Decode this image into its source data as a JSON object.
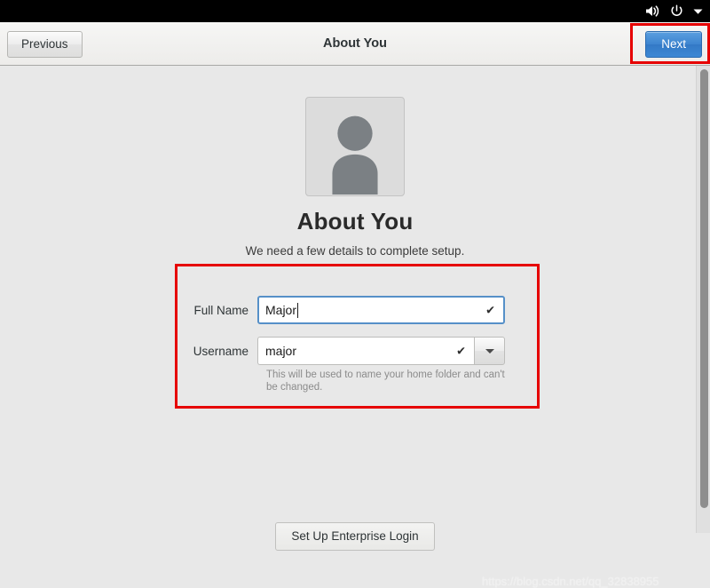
{
  "system_bar": {
    "icons": [
      {
        "name": "volume-icon",
        "label": "Volume"
      },
      {
        "name": "power-icon",
        "label": "Power"
      },
      {
        "name": "chevron-down-icon",
        "label": "System menu"
      }
    ]
  },
  "header": {
    "title": "About You",
    "previous_label": "Previous",
    "next_label": "Next"
  },
  "main": {
    "avatar_alt": "user-avatar-placeholder",
    "title": "About You",
    "subtitle": "We need a few details to complete setup.",
    "fields": [
      {
        "name": "full-name",
        "label": "Full Name",
        "value": "Major",
        "placeholder": "",
        "focused": true,
        "valid_icon": "✔",
        "has_dropdown": false
      },
      {
        "name": "username",
        "label": "Username",
        "value": "major",
        "placeholder": "",
        "focused": false,
        "valid_icon": "✔",
        "has_dropdown": true
      }
    ],
    "hint": "This will be used to name your home folder and can't be changed.",
    "enterprise_login_label": "Set Up Enterprise Login"
  },
  "annotations": {
    "accent_color": "#e60000",
    "next_button_highlight": true,
    "form_highlight": true
  },
  "scrollbar": {
    "orientation": "vertical",
    "position": "right"
  },
  "watermark": {
    "text": "https://blog.csdn.net/qq_32838955"
  }
}
